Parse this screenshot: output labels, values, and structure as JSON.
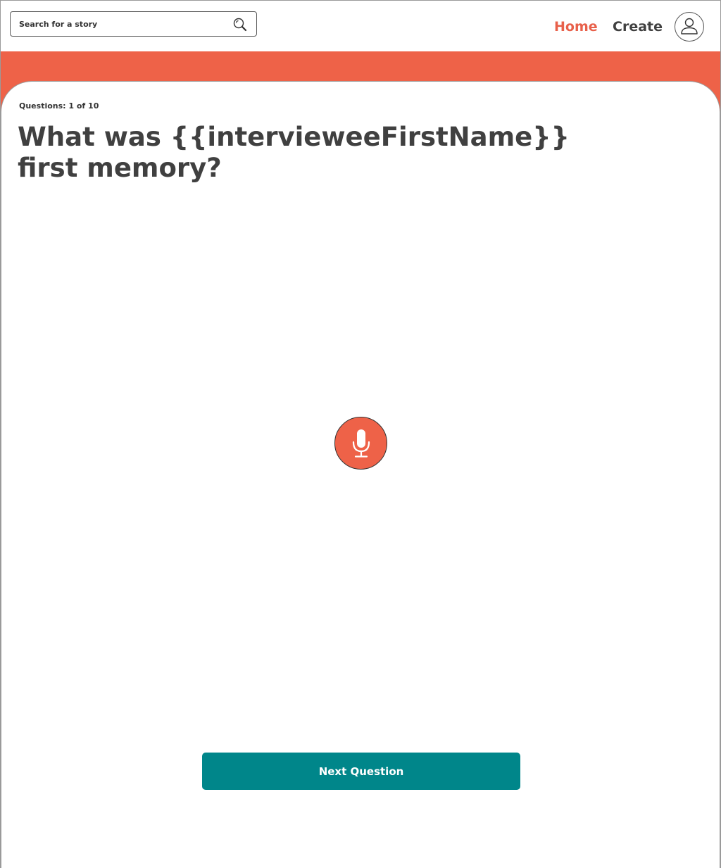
{
  "header": {
    "search": {
      "placeholder": "Search for a story",
      "icon": "search-icon"
    },
    "nav": {
      "home_label": "Home",
      "create_label": "Create"
    },
    "avatar_icon": "user-icon"
  },
  "question": {
    "counter": "Questions: 1 of 10",
    "text": "What was {{intervieweeFirstName}} first memory?"
  },
  "recorder": {
    "icon": "microphone-icon"
  },
  "actions": {
    "next_label": "Next Question"
  },
  "colors": {
    "accent": "#ee6248",
    "primary_button": "#00868a",
    "text": "#404040"
  }
}
